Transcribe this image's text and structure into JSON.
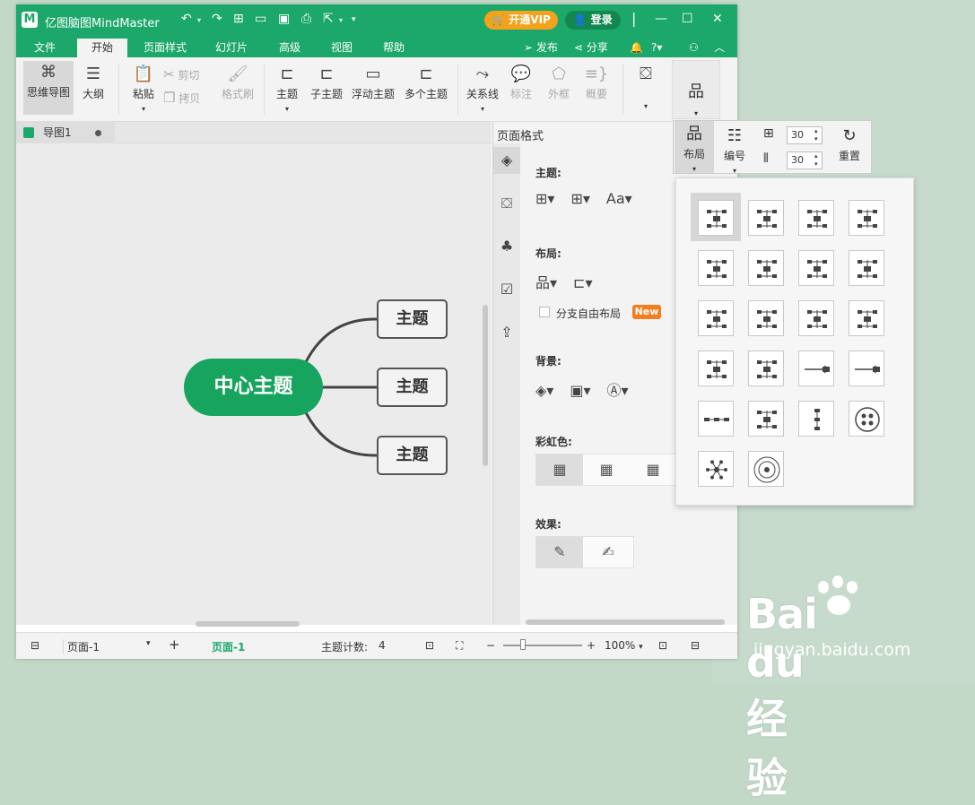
{
  "app": {
    "logo": "M",
    "title": "亿图脑图MindMaster",
    "vip_label": "开通VIP",
    "login_label": "登录"
  },
  "menu": {
    "tabs": [
      "文件",
      "开始",
      "页面样式",
      "幻灯片",
      "高级",
      "视图",
      "帮助"
    ],
    "active_tab": "开始",
    "publish": "发布",
    "share": "分享"
  },
  "ribbon": {
    "mindmap": "思维导图",
    "outline": "大纲",
    "paste": "粘贴",
    "cut": "剪切",
    "copy": "拷贝",
    "format_painter": "格式刷",
    "topic": "主题",
    "subtopic": "子主题",
    "floating_topic": "浮动主题",
    "multiple_topics": "多个主题",
    "relationship": "关系线",
    "callout": "标注",
    "boundary": "外框",
    "summary": "概要"
  },
  "layout_toolbar": {
    "layout": "布局",
    "numbering": "编号",
    "h_spacing": "30",
    "v_spacing": "30",
    "reset": "重置"
  },
  "document": {
    "tab_name": "导图1"
  },
  "canvas": {
    "center_topic": "中心主题",
    "topics": [
      "主题",
      "主题",
      "主题"
    ]
  },
  "panel": {
    "title": "页面格式",
    "theme_label": "主题:",
    "layout_label": "布局:",
    "free_layout": "分支自由布局",
    "new_badge": "New",
    "background_label": "背景:",
    "rainbow_label": "彩虹色:",
    "effect_label": "效果:"
  },
  "status": {
    "page_select": "页面-1",
    "page_tab": "页面-1",
    "topic_count_label": "主题计数:",
    "topic_count": "4",
    "zoom": "100%"
  },
  "watermark": {
    "brand": "Bai du 经验",
    "url": "jingyan.baidu.com"
  },
  "colors": {
    "brand_green": "#1ca86a",
    "center_topic": "#17a45e",
    "vip": "#f2a21b",
    "new_badge": "#f47d1e"
  }
}
